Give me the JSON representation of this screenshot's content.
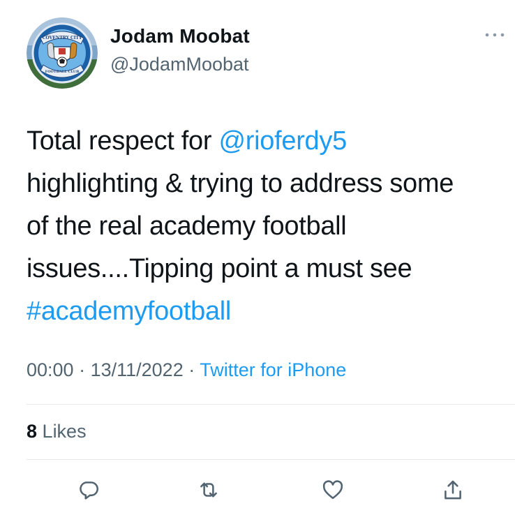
{
  "user": {
    "display_name": "Jodam Moobat",
    "handle": "@JodamMoobat",
    "avatar_icon": "coventry-city-badge-icon",
    "avatar_badge_text_top": "COVENTRY CITY",
    "avatar_badge_text_bottom": "FOOTBALL CLUB"
  },
  "tweet": {
    "line1_prefix": "Total respect for ",
    "mention": "@rioferdy5",
    "line2": "highlighting & trying to address some",
    "line3": "of the real academy football",
    "line4": "issues....Tipping point a must see",
    "hashtag": "#academyfootball"
  },
  "meta": {
    "time": "00:00",
    "date": "13/11/2022",
    "separator": " · ",
    "source": "Twitter for iPhone"
  },
  "stats": {
    "likes_count": "8",
    "likes_label": "Likes"
  },
  "actions": [
    {
      "name": "reply",
      "icon": "reply-icon"
    },
    {
      "name": "retweet",
      "icon": "retweet-icon"
    },
    {
      "name": "like",
      "icon": "heart-icon"
    },
    {
      "name": "share",
      "icon": "share-icon"
    }
  ],
  "colors": {
    "accent": "#1d9bf0",
    "text": "#0f1419",
    "secondary": "#536471",
    "divider": "#e6e9ec"
  }
}
